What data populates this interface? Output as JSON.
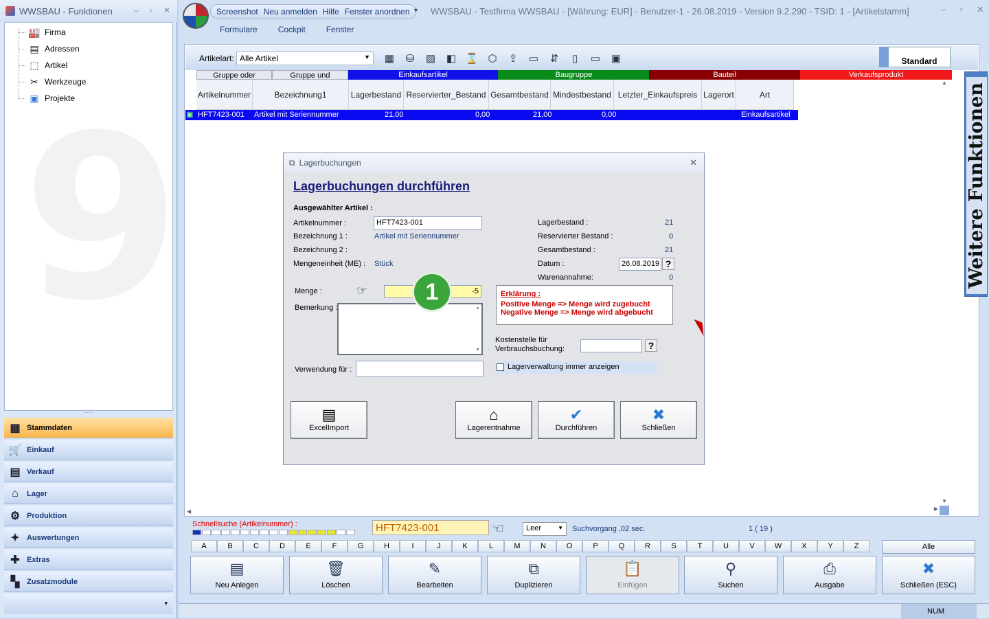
{
  "left_panel": {
    "title": "WWSBAU - Funktionen",
    "tree": [
      "Firma",
      "Adressen",
      "Artikel",
      "Werkzeuge",
      "Projekte"
    ],
    "nav": [
      "Stammdaten",
      "Einkauf",
      "Verkauf",
      "Lager",
      "Produktion",
      "Auswertungen",
      "Extras",
      "Zusatzmodule"
    ]
  },
  "quickbar": [
    "Screenshot",
    "Neu anmelden",
    "Hilfe",
    "Fenster anordnen"
  ],
  "window_title": "WWSBAU - Testfirma WWSBAU - [Währung: EUR] - Benutzer-1 - 26.08.2019 - Version 9.2.290 - TSID: 1  - [Artikelstamm]",
  "menu": [
    "Formulare",
    "Cockpit",
    "Fenster"
  ],
  "toolbar": {
    "artikelart_label": "Artikelart:",
    "artikelart_value": "Alle Artikel",
    "standard": "Standard"
  },
  "categories": [
    {
      "label": "Gruppe oder",
      "color": "#e4e8f0"
    },
    {
      "label": "Gruppe und",
      "color": "#e4e8f0"
    },
    {
      "label": "Einkaufsartikel",
      "color": "#1010e8"
    },
    {
      "label": "Baugruppe",
      "color": "#0a8a1a"
    },
    {
      "label": "Bauteil",
      "color": "#8a0000"
    },
    {
      "label": "Verkaufsprodukt",
      "color": "#f01818"
    }
  ],
  "columns": [
    "Artikelnummer",
    "Bezeichnung1",
    "Lagerbestand",
    "Reservierter_Bestand",
    "Gesamtbestand",
    "Mindestbestand",
    "Letzter_Einkaufspreis",
    "Lagerort",
    "Art"
  ],
  "row": {
    "artikelnummer": "HFT7423-001",
    "bezeichnung": "Artikel mit Seriennummer",
    "lagerbestand": "21,00",
    "reserviert": "0,00",
    "gesamt": "21,00",
    "mindest": "0,00",
    "art": "Einkaufsartikel"
  },
  "side_panel": "Weitere Funktionen",
  "dialog": {
    "title": "Lagerbuchungen",
    "heading": "Lagerbuchungen durchführen",
    "section": "Ausgewählter Artikel :",
    "labels": {
      "artikelnummer": "Artikelnummer :",
      "bez1": "Bezeichnung 1 :",
      "bez2": "Bezeichnung 2 :",
      "me": "Mengeneinheit (ME) :",
      "menge": "Menge :",
      "bemerkung": "Bemerkung :",
      "verwendung": "Verwendung für :",
      "lagerbestand": "Lagerbestand :",
      "reserviert": "Reservierter Bestand :",
      "gesamt": "Gesamtbestand :",
      "datum": "Datum :",
      "warenannahme": "Warenannahme:",
      "kostenstelle": "Kostenstelle für",
      "verbrauch": "Verbrauchsbuchung:",
      "checkbox": "Lagerverwaltung immer anzeigen"
    },
    "values": {
      "artikelnummer": "HFT7423-001",
      "bez1": "Artikel mit Seriennummer",
      "me": "Stück",
      "menge": "-5",
      "lagerbestand": "21",
      "reserviert": "0",
      "gesamt": "21",
      "datum": "26.08.2019",
      "warenannahme": "0"
    },
    "erklaerung": {
      "title": "Erklärung :",
      "line1": "Positive Menge => Menge wird zugebucht",
      "line2": "Negative Menge  => Menge wird abgebucht"
    },
    "buttons": [
      "ExcelImport",
      "Lagerentnahme",
      "Durchführen",
      "Schließen"
    ],
    "badge": "1"
  },
  "schnellsuche": {
    "label": "Schnellsuche (Artikelnummer) :",
    "value": "HFT7423-001",
    "leer": "Leer",
    "suchvorgang": "Suchvorgang ,02 sec.",
    "count": "1  ( 19 )"
  },
  "alphabet": [
    "A",
    "B",
    "C",
    "D",
    "E",
    "F",
    "G",
    "H",
    "I",
    "J",
    "K",
    "L",
    "M",
    "N",
    "O",
    "P",
    "Q",
    "R",
    "S",
    "T",
    "U",
    "V",
    "W",
    "X",
    "Y",
    "Z"
  ],
  "alle": "Alle",
  "bottom_buttons": [
    "Neu Anlegen",
    "Löschen",
    "Bearbeiten",
    "Duplizieren",
    "Einfügen",
    "Suchen",
    "Ausgabe",
    "Schließen (ESC)"
  ],
  "status": "NUM"
}
